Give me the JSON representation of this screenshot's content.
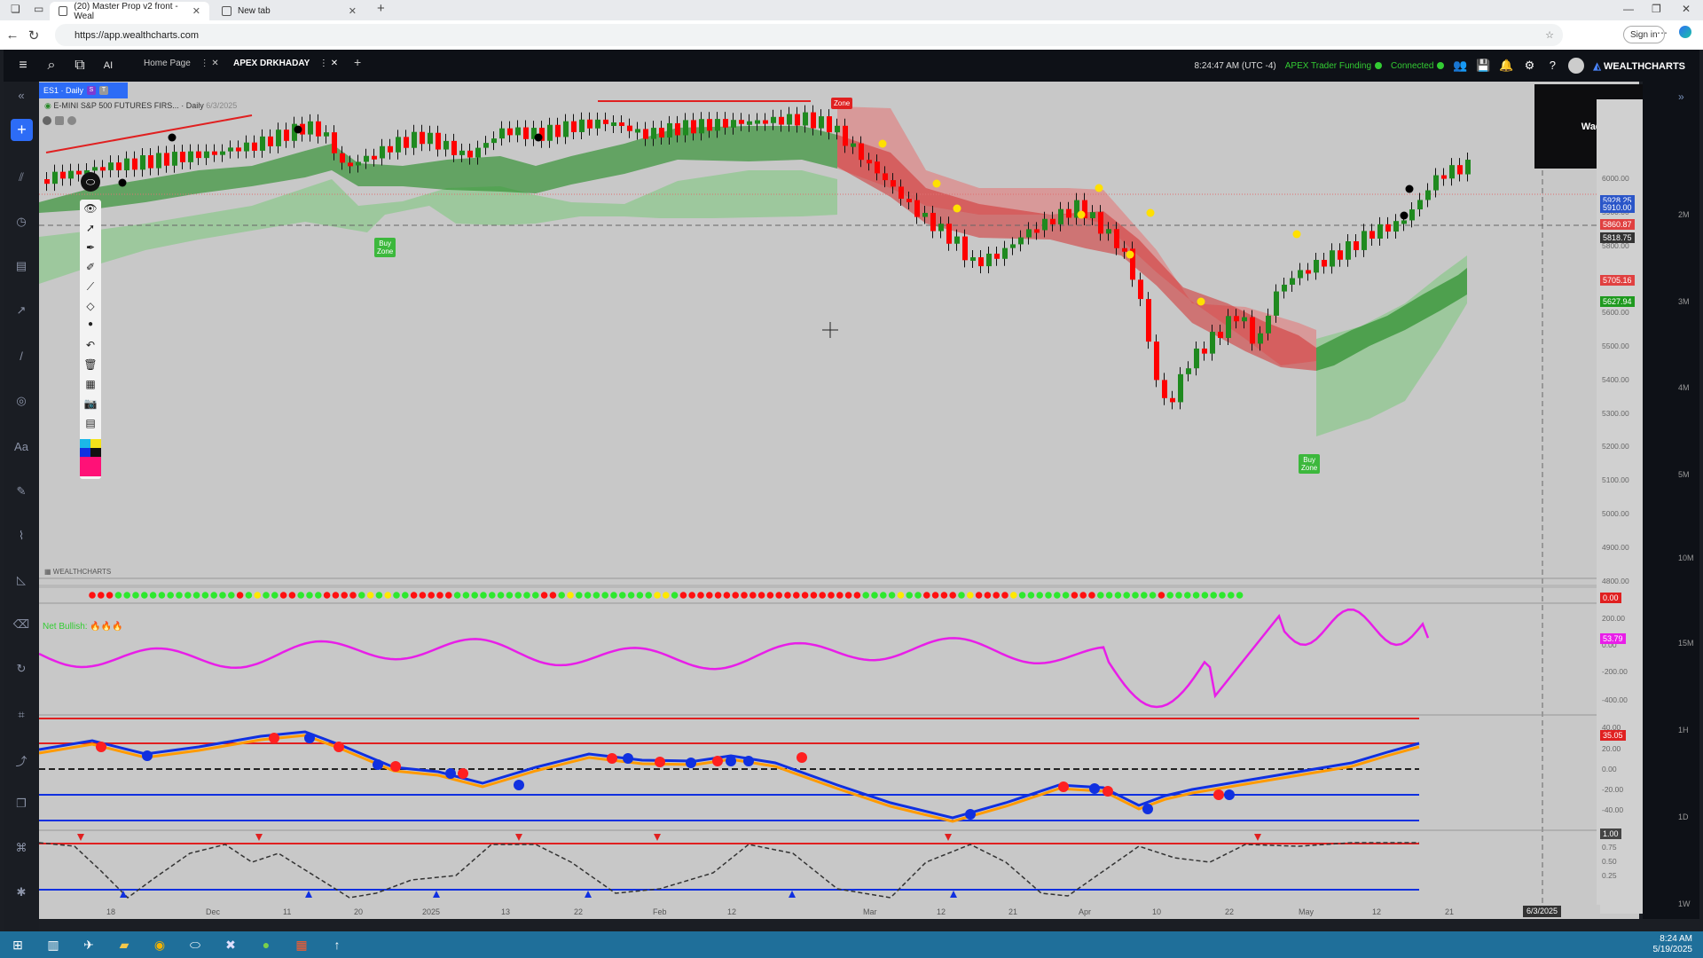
{
  "browser": {
    "tabs": [
      {
        "title": "(20) Master Prop v2 front - Weal",
        "close": "✕"
      },
      {
        "title": "New tab",
        "close": "✕"
      }
    ],
    "new_tab": "+",
    "url": "https://app.wealthcharts.com",
    "sign_in": "Sign in"
  },
  "app": {
    "tabs": [
      {
        "label": "Home Page"
      },
      {
        "label": "APEX DRKHADAY"
      }
    ],
    "add_tab": "+",
    "time": "8:24:47 AM",
    "timezone": "(UTC -4)",
    "broker": "APEX Trader Funding",
    "connection": "Connected",
    "brand": "WEALTHCHARTS"
  },
  "chart": {
    "symbol_tab": "ES1 · Daily",
    "badge_s": "S",
    "badge_t": "T",
    "title": "E-MINI S&P 500 FUTURES FIRS... · Daily",
    "title_date": "6/3/2025",
    "user_box": "Wade, Keith",
    "watermark": "WEALTHCHARTS",
    "net_bullish": "Net Bullish:",
    "zone_top": "Zone",
    "buy_zone": "Buy\nZone",
    "date_cursor": "6/3/2025",
    "colors": {
      "bull": "#1f8a1f",
      "bear": "#ff0000",
      "magenta": "#e81ee8",
      "blue": "#1030e0",
      "orange": "#ff9a00"
    },
    "price_ticks": [
      "6000.00",
      "5900.00",
      "5800.00",
      "5700.00",
      "5600.00",
      "5500.00",
      "5400.00",
      "5300.00",
      "5200.00",
      "5100.00",
      "5000.00",
      "4900.00",
      "4800.00"
    ],
    "price_labels": [
      {
        "text": "5928.25",
        "color": "#2a55c8"
      },
      {
        "text": "5910.00",
        "color": "#2a55c8"
      },
      {
        "text": "5860.87",
        "color": "#e04040"
      },
      {
        "text": "5818.75",
        "color": "#333333"
      },
      {
        "text": "5705.16",
        "color": "#e04040"
      },
      {
        "text": "5627.94",
        "color": "#1f9a1f"
      }
    ],
    "ind1_value": "0.00",
    "ind2_ticks": [
      "200.00",
      "0.00",
      "-200.00",
      "-400.00"
    ],
    "ind2_value": "53.79",
    "ind3_ticks": [
      "40.00",
      "20.00",
      "0.00",
      "-20.00",
      "-40.00"
    ],
    "ind3_value": "35.05",
    "ind4_ticks": [
      "0.75",
      "0.50",
      "0.25"
    ],
    "ind4_value": "1.00",
    "right_scale": [
      "2M",
      "3M",
      "4M",
      "5M",
      "10M",
      "15M",
      "1H",
      "1D",
      "1W"
    ],
    "time_labels": [
      "18",
      "Dec",
      "11",
      "20",
      "2025",
      "13",
      "22",
      "Feb",
      "12",
      "Mar",
      "12",
      "21",
      "Apr",
      "10",
      "22",
      "May",
      "12",
      "21"
    ]
  },
  "taskbar": {
    "time": "8:24 AM",
    "date": "5/19/2025"
  }
}
